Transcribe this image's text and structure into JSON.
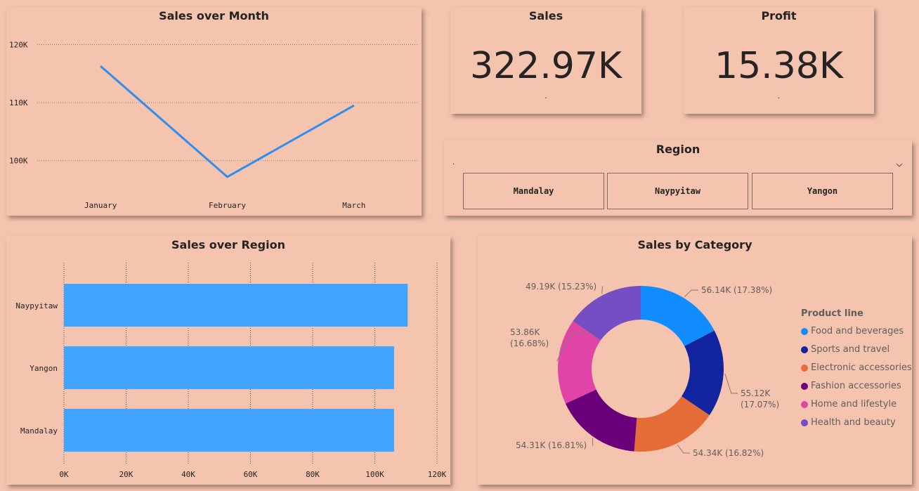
{
  "colors": {
    "background": "#f5c4af",
    "line": "#2f8cf0",
    "bar": "#41a4ff",
    "pie": [
      "#118dff",
      "#12239e",
      "#e66c37",
      "#6b007b",
      "#e044a7",
      "#744ec2"
    ]
  },
  "sales_card": {
    "title": "Sales",
    "value": "322.97K",
    "sub": "."
  },
  "profit_card": {
    "title": "Profit",
    "value": "15.38K",
    "sub": "."
  },
  "region_slicer": {
    "title": "Region",
    "selected": ".",
    "chevron_icon": "chevron-down-icon",
    "options": [
      "Mandalay",
      "Naypyitaw",
      "Yangon"
    ]
  },
  "chart_data": [
    {
      "type": "line",
      "title": "Sales over Month",
      "categories": [
        "January",
        "February",
        "March"
      ],
      "values": [
        116300,
        97200,
        109500
      ],
      "ylim": [
        95000,
        122000
      ],
      "yticks": [
        100000,
        110000,
        120000
      ],
      "ytick_labels": [
        "100K",
        "110K",
        "120K"
      ],
      "grid": true
    },
    {
      "type": "bar",
      "orientation": "horizontal",
      "title": "Sales over Region",
      "categories": [
        "Naypyitaw",
        "Yangon",
        "Mandalay"
      ],
      "values": [
        110570,
        106200,
        106200
      ],
      "xlim": [
        0,
        120000
      ],
      "xticks": [
        0,
        20000,
        40000,
        60000,
        80000,
        100000,
        120000
      ],
      "xtick_labels": [
        "0K",
        "20K",
        "40K",
        "60K",
        "80K",
        "100K",
        "120K"
      ],
      "grid": true
    },
    {
      "type": "pie",
      "donut": true,
      "title": "Sales by Category",
      "legend_title": "Product line",
      "legend_position": "right",
      "categories": [
        "Food and beverages",
        "Sports and travel",
        "Electronic accessories",
        "Fashion accessories",
        "Home and lifestyle",
        "Health and beauty"
      ],
      "values": [
        56.14,
        55.12,
        54.34,
        54.31,
        53.86,
        49.19
      ],
      "percentages": [
        17.38,
        17.07,
        16.82,
        16.81,
        16.68,
        15.23
      ],
      "data_labels": [
        [
          "56.14K (17.38%)"
        ],
        [
          "55.12K",
          "(17.07%)"
        ],
        [
          "54.34K (16.82%)"
        ],
        [
          "54.31K (16.81%)"
        ],
        [
          "53.86K",
          "(16.68%)"
        ],
        [
          "49.19K (15.23%)"
        ]
      ]
    }
  ]
}
